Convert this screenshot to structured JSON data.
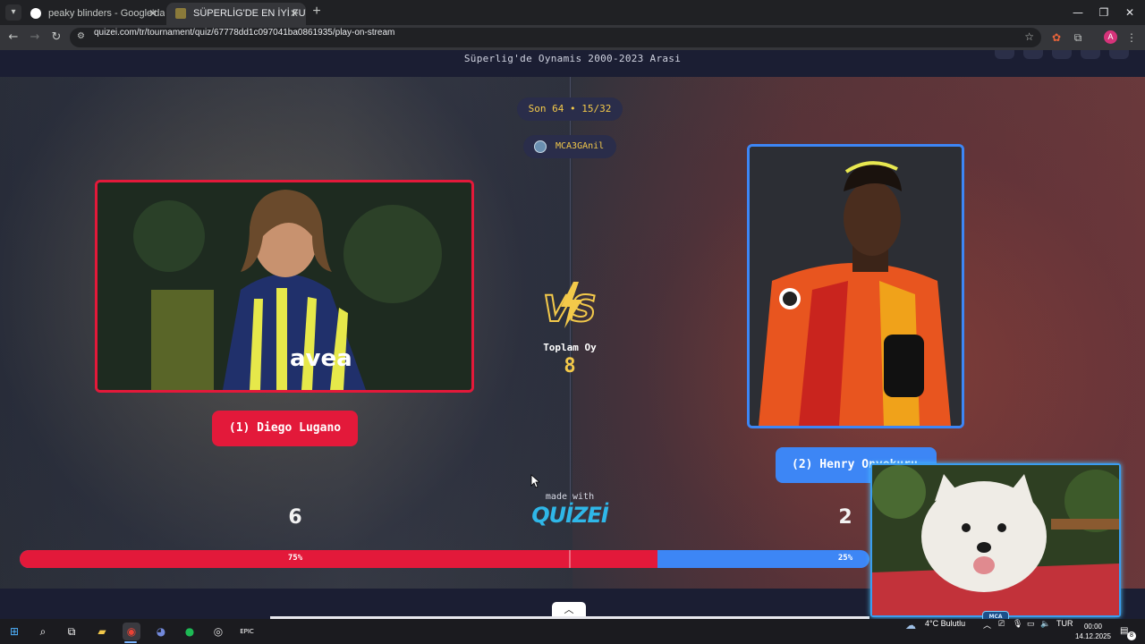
{
  "browser": {
    "tabs": [
      {
        "title": "peaky blinders - Google'da Ara",
        "active": false,
        "favicon": "google-icon"
      },
      {
        "title": "SÜPERLİG'DE EN İYİ FUTBOLCU",
        "active": true,
        "favicon": "quizei-icon"
      }
    ],
    "url": "quizei.com/tr/tournament/quiz/67778dd1c097041ba0861935/play-on-stream",
    "profile_initial": "A"
  },
  "page": {
    "quiz_title": "Süperlig'de Oynamis 2000-2023 Arasi",
    "round_label": "Son 64 • 15/32",
    "username": "MCA3GAnil",
    "total_votes_label": "Toplam Oy",
    "total_votes": "8",
    "made_with": "made with",
    "brand": "QUİZEİ",
    "left": {
      "name": "(1) Diego Lugano",
      "votes": "6",
      "percent_label": "75%",
      "percent": 75,
      "color": "#e3193a"
    },
    "right": {
      "name": "(2) Henry Onyekuru",
      "votes": "2",
      "percent_label": "25%",
      "percent": 25,
      "color": "#3d86f5"
    }
  },
  "taskbar": {
    "weather": "4°C  Bulutlu",
    "language": "TUR",
    "time": "00:00",
    "date": "14.12.2025",
    "notifications": "8"
  }
}
